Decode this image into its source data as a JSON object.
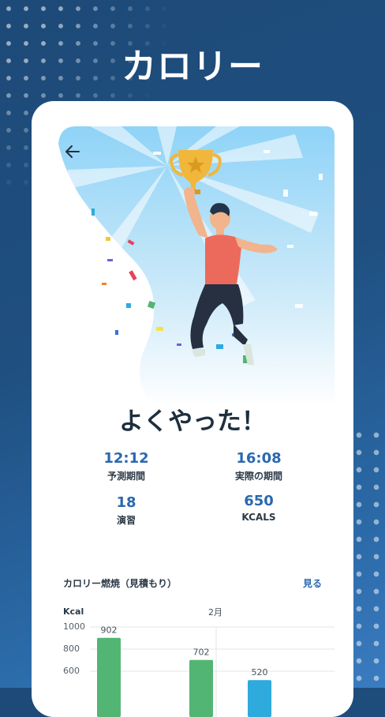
{
  "page": {
    "title": "カロリー"
  },
  "screen": {
    "headline": "よくやった！",
    "stats": [
      {
        "value": "12:12",
        "label": "予測期間"
      },
      {
        "value": "16:08",
        "label": "実際の期間"
      },
      {
        "value": "18",
        "label": "演習"
      },
      {
        "value": "650",
        "label": "KCALS"
      }
    ],
    "calorie_section": {
      "title": "カロリー燃焼（見積もり）",
      "link": "見る",
      "unit_label": "Kcal",
      "month_label": "2月"
    }
  },
  "colors": {
    "background": "#1f4f80",
    "accent": "#2a68b0",
    "bar_green": "#52b574",
    "bar_blue": "#2eaadc"
  },
  "icons": {
    "back": "arrow-left-icon",
    "trophy": "trophy-icon"
  },
  "chart_data": {
    "type": "bar",
    "ylabel": "Kcal",
    "xlabel": "2月",
    "yticks": [
      1000,
      800,
      600
    ],
    "ylim": [
      440,
      1000
    ],
    "values": [
      902,
      702,
      520
    ],
    "colors": [
      "#52b574",
      "#52b574",
      "#2eaadc"
    ],
    "grid": true
  }
}
